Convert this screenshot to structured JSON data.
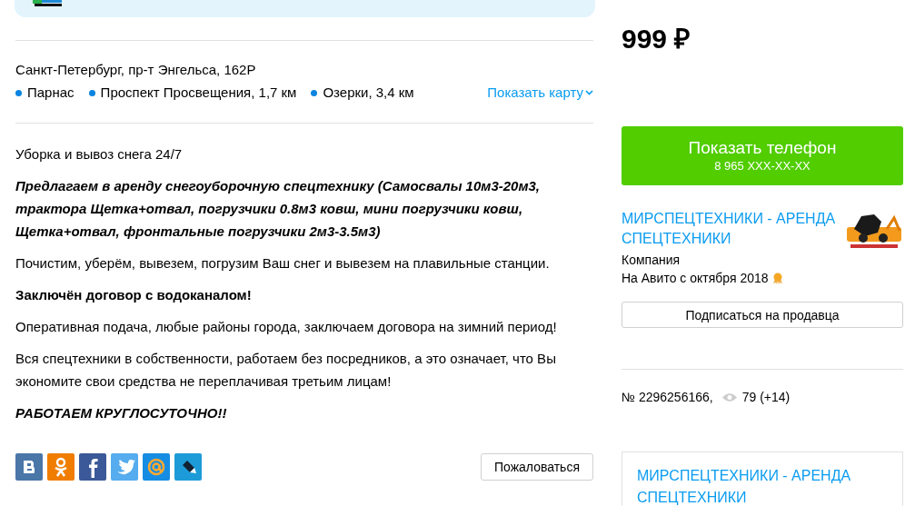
{
  "address": "Санкт-Петербург, пр-т Энгельса, 162Р",
  "metro": [
    {
      "name": "Парнас"
    },
    {
      "name": "Проспект Просвещения, 1,7 км"
    },
    {
      "name": "Озерки, 3,4 км"
    }
  ],
  "show_map": "Показать карту",
  "description": [
    {
      "kind": "plain",
      "text": "Уборка и вывоз снега 24/7"
    },
    {
      "kind": "bold-italic",
      "text": "Предлагаем в аренду снегоуборочную спецтехнику (Самосвалы 10м3-20м3, трактора Щетка+отвал, погрузчики 0.8м3 ковш, мини погрузчики ковш, Щетка+отвал, фронтальные погрузчики 2м3-3.5м3)"
    },
    {
      "kind": "plain",
      "text": "Почистим, уберём, вывезем, погрузим Ваш снег и вывезем на плавильные станции."
    },
    {
      "kind": "bold",
      "text": "Заключён договор с водоканалом!"
    },
    {
      "kind": "plain",
      "text": "Оперативная подача, любые районы города, заключаем договора на зимний период!"
    },
    {
      "kind": "plain",
      "text": "Вся спецтехники в собственности, работаем без посредников, а это означает, что Вы экономите свои средства не переплачивая третьим лицам!"
    },
    {
      "kind": "bold-italic",
      "text": "РАБОТАЕМ КРУГЛОСУТОЧНО!!"
    }
  ],
  "share": [
    {
      "kind": "vk"
    },
    {
      "kind": "ok"
    },
    {
      "kind": "fb"
    },
    {
      "kind": "tw"
    },
    {
      "kind": "mail"
    },
    {
      "kind": "lj"
    }
  ],
  "complain_button": "Пожаловаться",
  "price": "999 ₽",
  "phone_button": {
    "label": "Показать телефон",
    "number": "8 965 XXX-XX-XX"
  },
  "seller": {
    "name": "МИРСПЕЦТЕХНИКИ - АРЕНДА СПЕЦТЕХНИКИ",
    "type": "Компания",
    "since": "На Авито с октября 2018"
  },
  "subscribe_button": "Подписаться на продавца",
  "ad_number": "№ 2296256166,",
  "views": "79 (+14)",
  "seller_box": {
    "name": "МИРСПЕЦТЕХНИКИ - АРЕНДА СПЕЦТЕХНИКИ"
  }
}
